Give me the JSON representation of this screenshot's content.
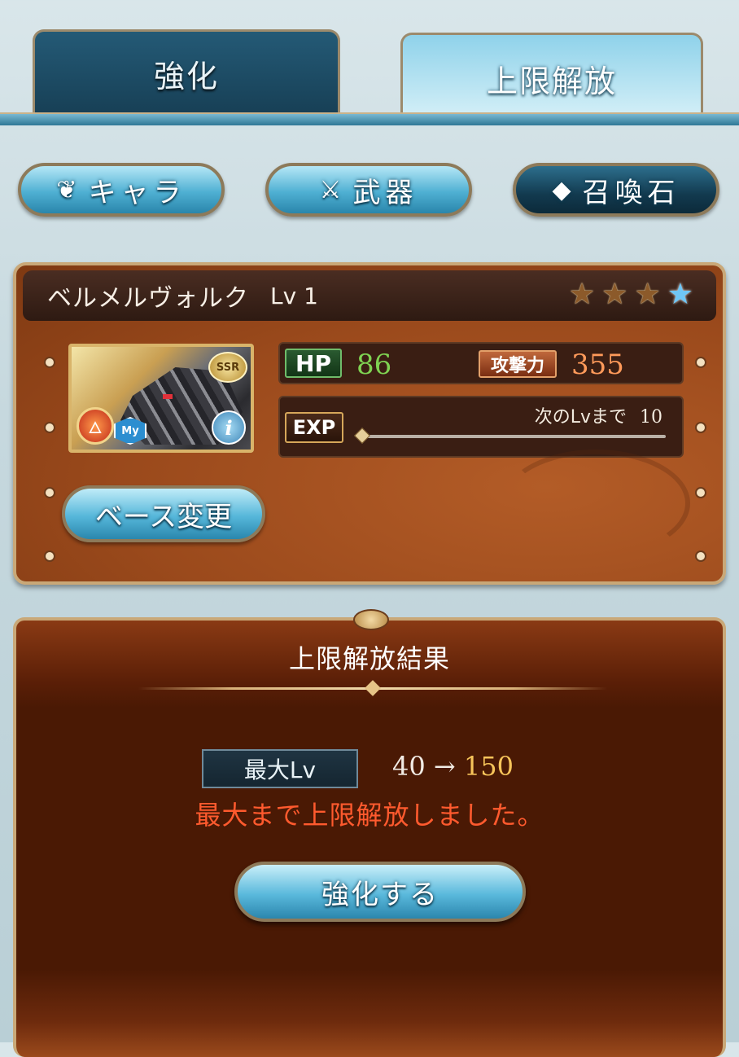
{
  "tabs": [
    {
      "label": "強化",
      "active": false
    },
    {
      "label": "上限解放",
      "active": true
    }
  ],
  "categories": [
    {
      "label": "キャラ",
      "icon": "character-emblem-icon",
      "selected": false
    },
    {
      "label": "武器",
      "icon": "crossed-weapons-icon",
      "selected": false
    },
    {
      "label": "召喚石",
      "icon": "crystal-icon",
      "selected": true
    }
  ],
  "character": {
    "name": "ベルメルヴォルク",
    "level_text": "Lv 1",
    "rarity_badge": "SSR",
    "my_badge": "My",
    "stars_total": 4,
    "stars_filled": 1,
    "hp_label": "HP",
    "hp_value": "86",
    "atk_label": "攻撃力",
    "atk_value": "355",
    "exp_label": "EXP",
    "next_lv_label": "次のLvまで",
    "next_lv_value": "10",
    "exp_progress": 0.0,
    "base_change_label": "ベース変更"
  },
  "result": {
    "title": "上限解放結果",
    "max_lv_label": "最大Lv",
    "from_lv": "40",
    "arrow": "→",
    "to_lv": "150",
    "message": "最大まで上限解放しました。",
    "enhance_button_label": "強化する"
  },
  "colors": {
    "hp_value": "#7fd352",
    "atk_value": "#ff9a5a",
    "to_lv": "#f6c45a",
    "message": "#ff5a2e"
  }
}
